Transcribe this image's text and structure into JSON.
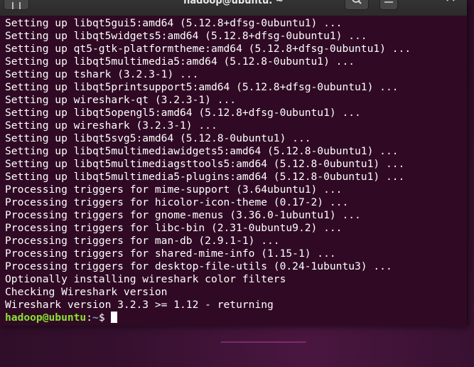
{
  "window": {
    "title": "hadoop@ubuntu: ~"
  },
  "terminal": {
    "lines": [
      "Setting up libqt5gui5:amd64 (5.12.8+dfsg-0ubuntu1) ...",
      "Setting up libqt5widgets5:amd64 (5.12.8+dfsg-0ubuntu1) ...",
      "Setting up qt5-gtk-platformtheme:amd64 (5.12.8+dfsg-0ubuntu1) ...",
      "Setting up libqt5multimedia5:amd64 (5.12.8-0ubuntu1) ...",
      "Setting up tshark (3.2.3-1) ...",
      "Setting up libqt5printsupport5:amd64 (5.12.8+dfsg-0ubuntu1) ...",
      "Setting up wireshark-qt (3.2.3-1) ...",
      "Setting up libqt5opengl5:amd64 (5.12.8+dfsg-0ubuntu1) ...",
      "Setting up wireshark (3.2.3-1) ...",
      "Setting up libqt5svg5:amd64 (5.12.8-0ubuntu1) ...",
      "Setting up libqt5multimediawidgets5:amd64 (5.12.8-0ubuntu1) ...",
      "Setting up libqt5multimediagsttools5:amd64 (5.12.8-0ubuntu1) ...",
      "Setting up libqt5multimedia5-plugins:amd64 (5.12.8-0ubuntu1) ...",
      "Processing triggers for mime-support (3.64ubuntu1) ...",
      "Processing triggers for hicolor-icon-theme (0.17-2) ...",
      "Processing triggers for gnome-menus (3.36.0-1ubuntu1) ...",
      "Processing triggers for libc-bin (2.31-0ubuntu9.2) ...",
      "Processing triggers for man-db (2.9.1-1) ...",
      "Processing triggers for shared-mime-info (1.15-1) ...",
      "Processing triggers for desktop-file-utils (0.24-1ubuntu3) ...",
      "Optionally installing wireshark color filters",
      "Checking Wireshark version",
      "Wireshark version 3.2.3 >= 1.12 - returning"
    ],
    "prompt": {
      "user_host": "hadoop@ubuntu",
      "separator": ":",
      "path": "~",
      "symbol": "$ "
    }
  },
  "colors": {
    "terminal_bg": "#300a24",
    "text": "#ffffff",
    "prompt_user": "#8ae234",
    "prompt_path": "#729fcf"
  },
  "icons": {
    "new_tab": "new-tab-icon",
    "search": "search-icon",
    "menu": "hamburger-menu-icon",
    "close": "close-icon"
  }
}
